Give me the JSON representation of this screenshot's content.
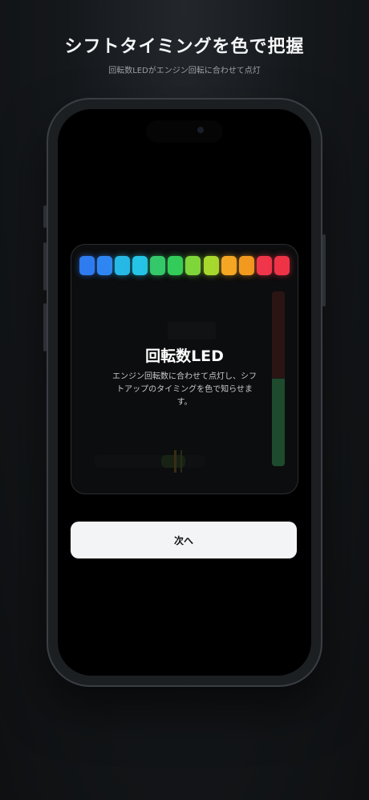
{
  "header": {
    "title": "シフトタイミングを色で把握",
    "subtitle": "回転数LEDがエンジン回転に合わせて点灯"
  },
  "card": {
    "title": "回転数LED",
    "description": "エンジン回転数に合わせて点灯し、シフトアップのタイミングを色で知らせます。",
    "leds": [
      {
        "color": "#2f7bf0"
      },
      {
        "color": "#2f86f2"
      },
      {
        "color": "#26b9e6"
      },
      {
        "color": "#25c3e6"
      },
      {
        "color": "#35c86a"
      },
      {
        "color": "#33cc5a"
      },
      {
        "color": "#7fd63a"
      },
      {
        "color": "#a6d82e"
      },
      {
        "color": "#f5a623"
      },
      {
        "color": "#f29a1f"
      },
      {
        "color": "#f0364a"
      },
      {
        "color": "#ee3346"
      }
    ],
    "gauge_level": 0.5
  },
  "actions": {
    "next_label": "次へ"
  }
}
